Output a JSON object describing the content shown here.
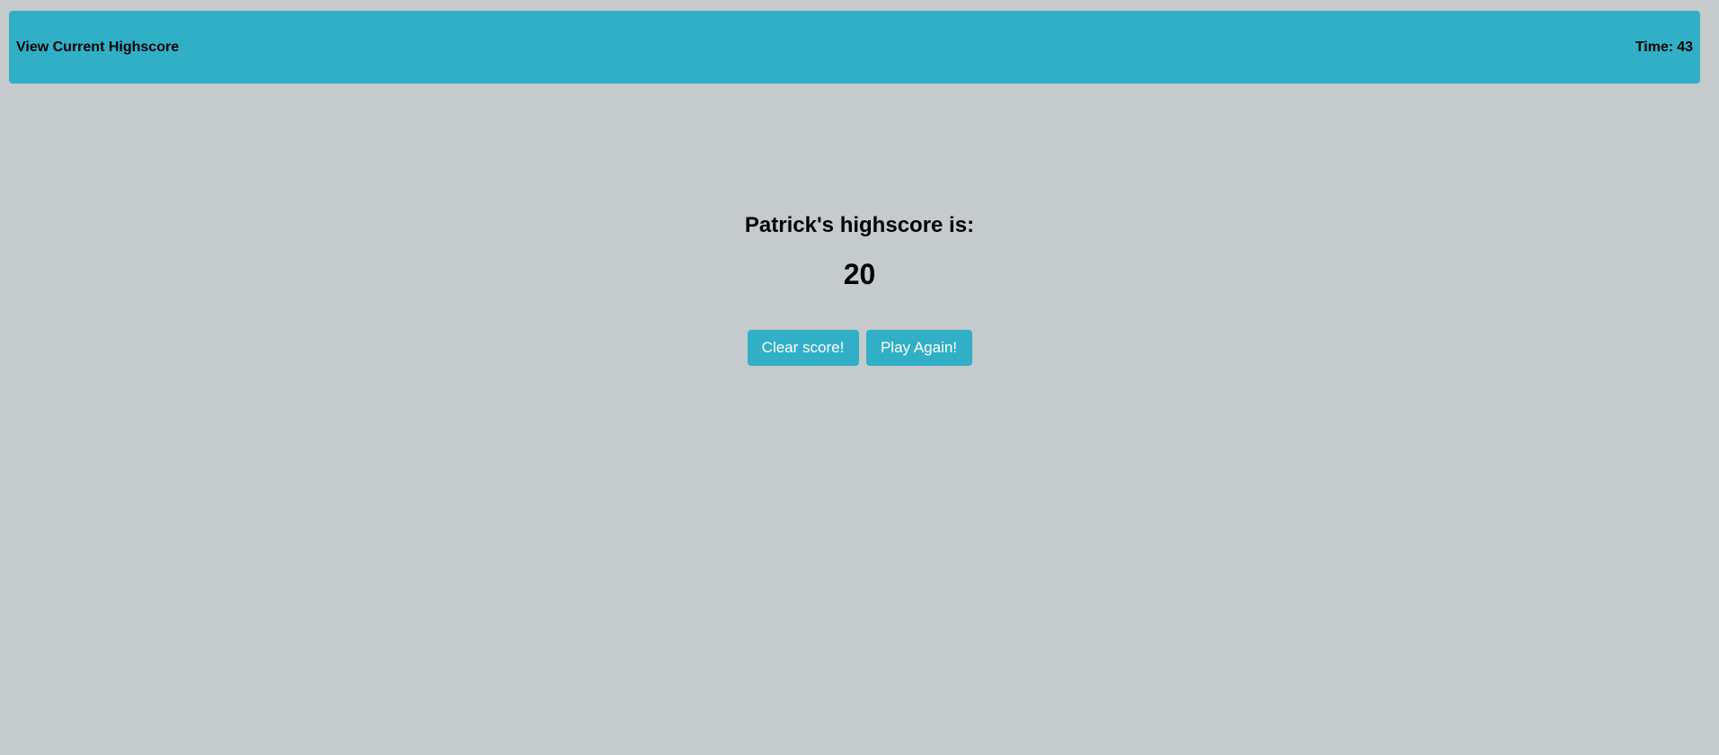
{
  "header": {
    "view_highscore_label": "View Current Highscore",
    "time_label": "Time:",
    "time_value": "43"
  },
  "result": {
    "heading": "Patrick's highscore is:",
    "score": "20"
  },
  "actions": {
    "clear_label": "Clear score!",
    "play_again_label": "Play Again!"
  },
  "colors": {
    "accent": "#31afc6",
    "background": "#c5cacd",
    "button_text": "#ffffff"
  }
}
